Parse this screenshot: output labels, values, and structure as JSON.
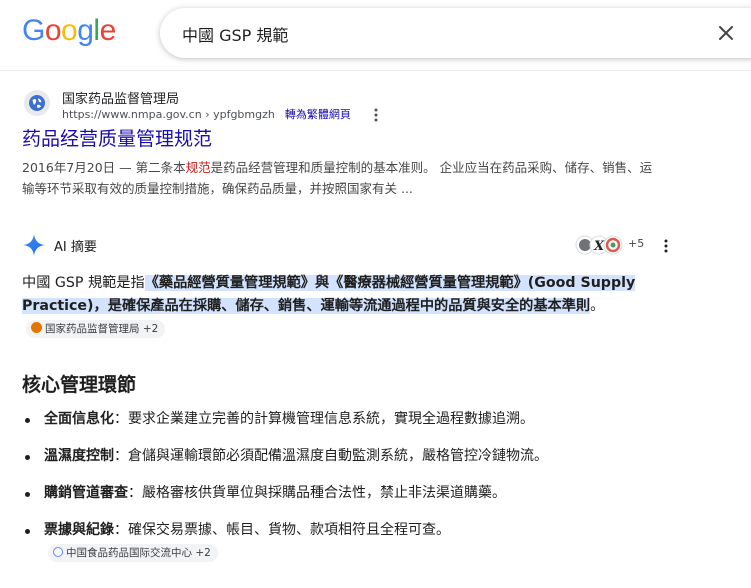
{
  "header": {
    "logo_text": "Google",
    "logo_colors": [
      "#4285F4",
      "#EA4335",
      "#FBBC05",
      "#4285F4",
      "#34A853",
      "#EA4335"
    ],
    "search_query": "中國 GSP 規範",
    "clear_icon": "close-icon"
  },
  "result": {
    "site_name": "国家药品监督管理局",
    "url": "https://www.nmpa.gov.cn › ypfgbmgzh",
    "translate_label": "轉為繁體網頁",
    "title": "药品经营质量管理规范",
    "snippet_date": "2016年7月20日",
    "snippet_pre": " — 第二条本",
    "snippet_highlight": "规范",
    "snippet_post": "是药品经营管理和质量控制的基本准则。 企业应当在药品采购、储存、销售、运输等环节采取有效的质量控制措施，确保药品质量，并按照国家有关 ..."
  },
  "ai": {
    "label": "AI 摘要",
    "source_count": "+5",
    "intro_plain": "中國 GSP 規範是指",
    "intro_highlight": "《藥品經營質量管理規範》與《醫療器械經營質量管理規範》(Good Supply Practice)，是確保產品在採購、儲存、銷售、運輸等流通過程中的品質與安全的基本準則",
    "intro_end": "。",
    "intro_chip": "国家药品监督管理局 +2",
    "section_title": "核心管理環節",
    "items": [
      {
        "term": "全面信息化",
        "sep": "：",
        "desc": "要求企業建立完善的計算機管理信息系統，實現全過程數據追溯。"
      },
      {
        "term": "溫濕度控制",
        "sep": "：",
        "desc": "倉儲與運輸環節必須配備溫濕度自動監測系統，嚴格管控冷鏈物流。"
      },
      {
        "term": "購銷管道審查",
        "sep": "：",
        "desc": "嚴格審核供貨單位與採購品種合法性，禁止非法渠道購藥。"
      },
      {
        "term": "票據與紀錄",
        "sep": "：",
        "desc": "確保交易票據、帳目、貨物、款項相符且全程可查。"
      }
    ],
    "last_chip": "中国食品药品国际交流中心 +2"
  }
}
